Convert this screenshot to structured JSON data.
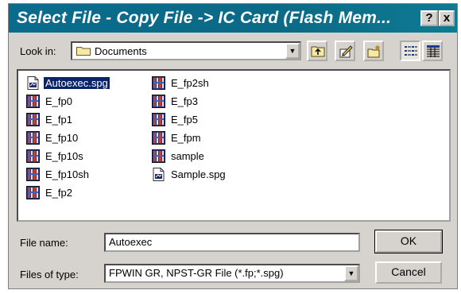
{
  "window": {
    "title": "Select File - Copy File -> IC Card (Flash Mem...",
    "help_label": "?",
    "close_label": "x",
    "title_bar_color": "#0a6b8c"
  },
  "look_in": {
    "label": "Look in:",
    "value": "Documents",
    "icon": "folder-icon"
  },
  "toolbar": [
    {
      "name": "up-one-level-button",
      "icon": "up-folder-icon"
    },
    {
      "name": "desktop-button",
      "icon": "desktop-icon"
    },
    {
      "name": "new-folder-button",
      "icon": "new-folder-icon"
    },
    {
      "name": "list-view-button",
      "icon": "list-view-icon"
    },
    {
      "name": "details-view-button",
      "icon": "details-view-icon"
    }
  ],
  "files": {
    "column1": [
      {
        "label": "Autoexec.spg",
        "type": "spg",
        "selected": true
      },
      {
        "label": "E_fp0",
        "type": "fp"
      },
      {
        "label": "E_fp1",
        "type": "fp"
      },
      {
        "label": "E_fp10",
        "type": "fp"
      },
      {
        "label": "E_fp10s",
        "type": "fp"
      },
      {
        "label": "E_fp10sh",
        "type": "fp"
      },
      {
        "label": "E_fp2",
        "type": "fp"
      }
    ],
    "column2": [
      {
        "label": "E_fp2sh",
        "type": "fp"
      },
      {
        "label": "E_fp3",
        "type": "fp"
      },
      {
        "label": "E_fp5",
        "type": "fp"
      },
      {
        "label": "E_fpm",
        "type": "fp"
      },
      {
        "label": "sample",
        "type": "fp"
      },
      {
        "label": "Sample.spg",
        "type": "spg"
      }
    ]
  },
  "file_name": {
    "label": "File name:",
    "value": "Autoexec"
  },
  "file_type": {
    "label": "Files of type:",
    "value": "FPWIN GR, NPST-GR File (*.fp;*.spg)"
  },
  "buttons": {
    "ok": "OK",
    "cancel": "Cancel"
  }
}
